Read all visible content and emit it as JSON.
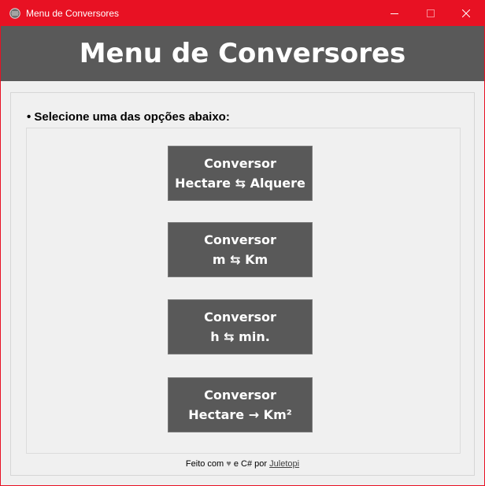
{
  "window": {
    "title": "Menu de Conversores",
    "accent_color": "#e81123",
    "controls": {
      "minimize_icon": "minimize-icon",
      "maximize_icon": "maximize-icon",
      "close_icon": "close-icon"
    }
  },
  "header": {
    "title": "Menu de Conversores",
    "background": "#595959"
  },
  "main": {
    "instruction": "• Selecione uma das opções abaixo:",
    "buttons": [
      {
        "line1": "Conversor",
        "line2": "Hectare ⇆ Alquere"
      },
      {
        "line1": "Conversor",
        "line2": "m ⇆ Km"
      },
      {
        "line1": "Conversor",
        "line2": "h ⇆ min."
      },
      {
        "line1": "Conversor",
        "line2": "Hectare → Km²"
      }
    ]
  },
  "footer": {
    "prefix": "Feito com",
    "heart": "♥",
    "middle": "e C# por",
    "link": "Juletopi"
  }
}
